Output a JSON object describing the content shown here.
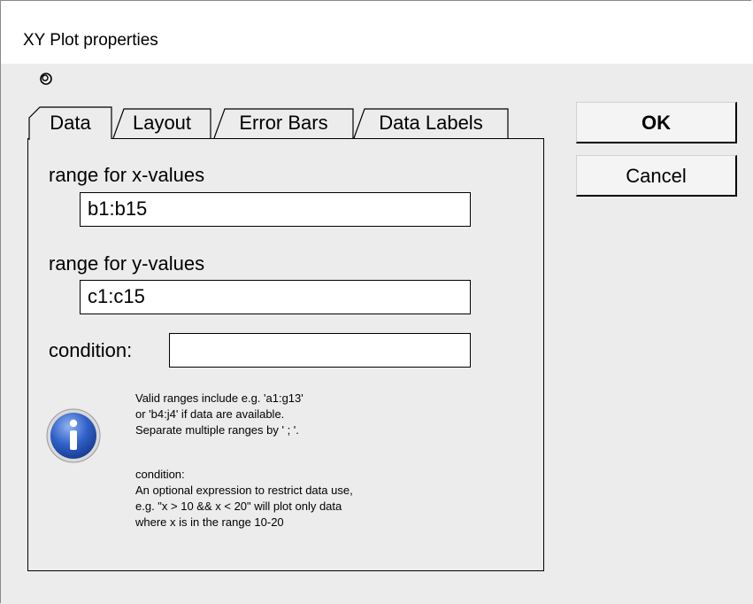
{
  "window": {
    "title": "XY Plot properties"
  },
  "tabs": [
    {
      "label": "Data",
      "active": true
    },
    {
      "label": "Layout",
      "active": false
    },
    {
      "label": "Error Bars",
      "active": false
    },
    {
      "label": "Data Labels",
      "active": false
    }
  ],
  "data_tab": {
    "x_label": "range for x-values",
    "x_value": "b1:b15",
    "y_label": "range for y-values",
    "y_value": "c1:c15",
    "condition_label": "condition:",
    "condition_value": "",
    "help_lines_1": [
      "Valid ranges include e.g. 'a1:g13'",
      "or 'b4:j4' if data are available.",
      "Separate multiple ranges by ' ; '."
    ],
    "help_lines_2": [
      "condition:",
      "An optional expression to restrict data use,",
      "e.g. \"x > 10 && x < 20\" will plot only data",
      "where x is in the range 10-20"
    ]
  },
  "buttons": {
    "ok": "OK",
    "cancel": "Cancel"
  },
  "icons": {
    "pin": "pin-icon",
    "info": "info-icon"
  }
}
